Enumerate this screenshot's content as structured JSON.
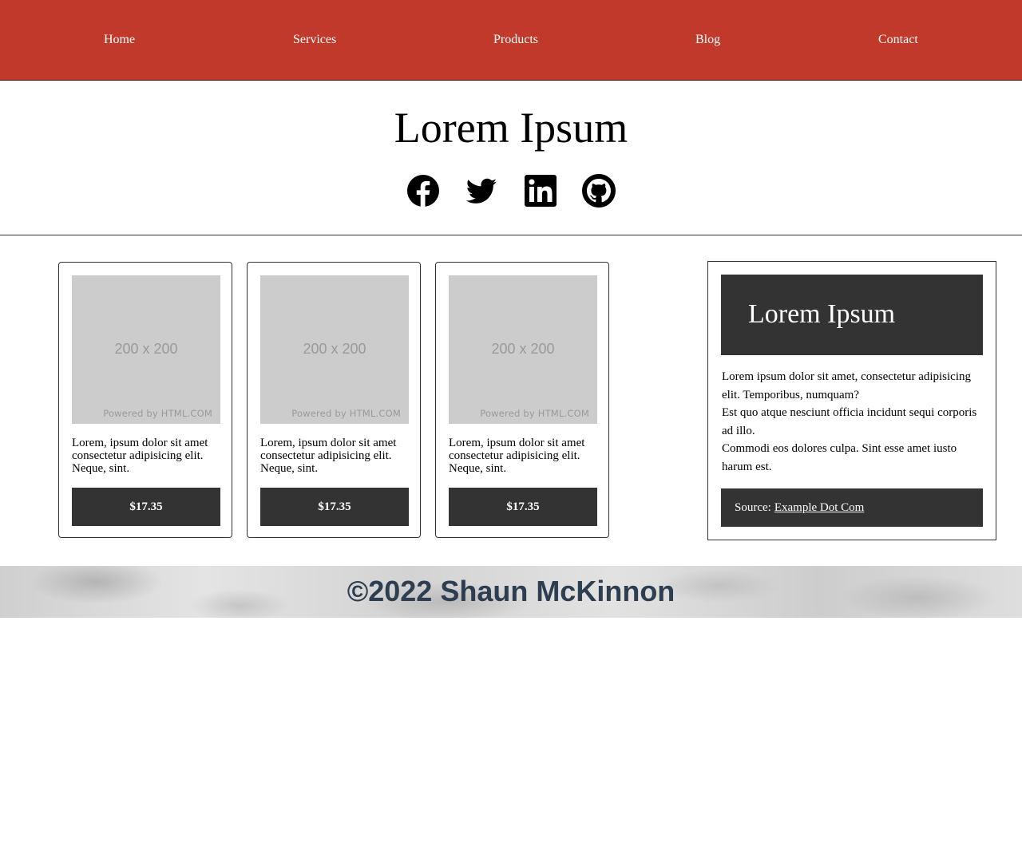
{
  "nav": {
    "items": [
      "Home",
      "Services",
      "Products",
      "Blog",
      "Contact"
    ]
  },
  "hero": {
    "title": "Lorem Ipsum",
    "social_icons": [
      "facebook-icon",
      "twitter-icon",
      "linkedin-icon",
      "github-icon"
    ]
  },
  "products": [
    {
      "image_dims": "200 x 200",
      "image_credit": "Powered by HTML.COM",
      "text": "Lorem, ipsum dolor sit amet consectetur adipisicing elit. Neque, sint.",
      "price": "$17.35"
    },
    {
      "image_dims": "200 x 200",
      "image_credit": "Powered by HTML.COM",
      "text": "Lorem, ipsum dolor sit amet consectetur adipisicing elit. Neque, sint.",
      "price": "$17.35"
    },
    {
      "image_dims": "200 x 200",
      "image_credit": "Powered by HTML.COM",
      "text": "Lorem, ipsum dolor sit amet consectetur adipisicing elit. Neque, sint.",
      "price": "$17.35"
    }
  ],
  "aside": {
    "title": "Lorem Ipsum",
    "paragraphs": [
      "Lorem ipsum dolor sit amet, consectetur adipisicing elit. Temporibus, numquam?",
      "Est quo atque nesciunt officia incidunt sequi corporis ad illo.",
      "Commodi eos dolores culpa. Sint esse amet iusto harum est."
    ],
    "source_label": "Source:",
    "source_link": "Example Dot Com"
  },
  "footer": {
    "text": "©2022 Shaun McKinnon"
  },
  "colors": {
    "nav_bg": "#c0392b",
    "dark_panel": "#333333",
    "footer_text": "#2c3e50",
    "placeholder": "#cccccc"
  }
}
